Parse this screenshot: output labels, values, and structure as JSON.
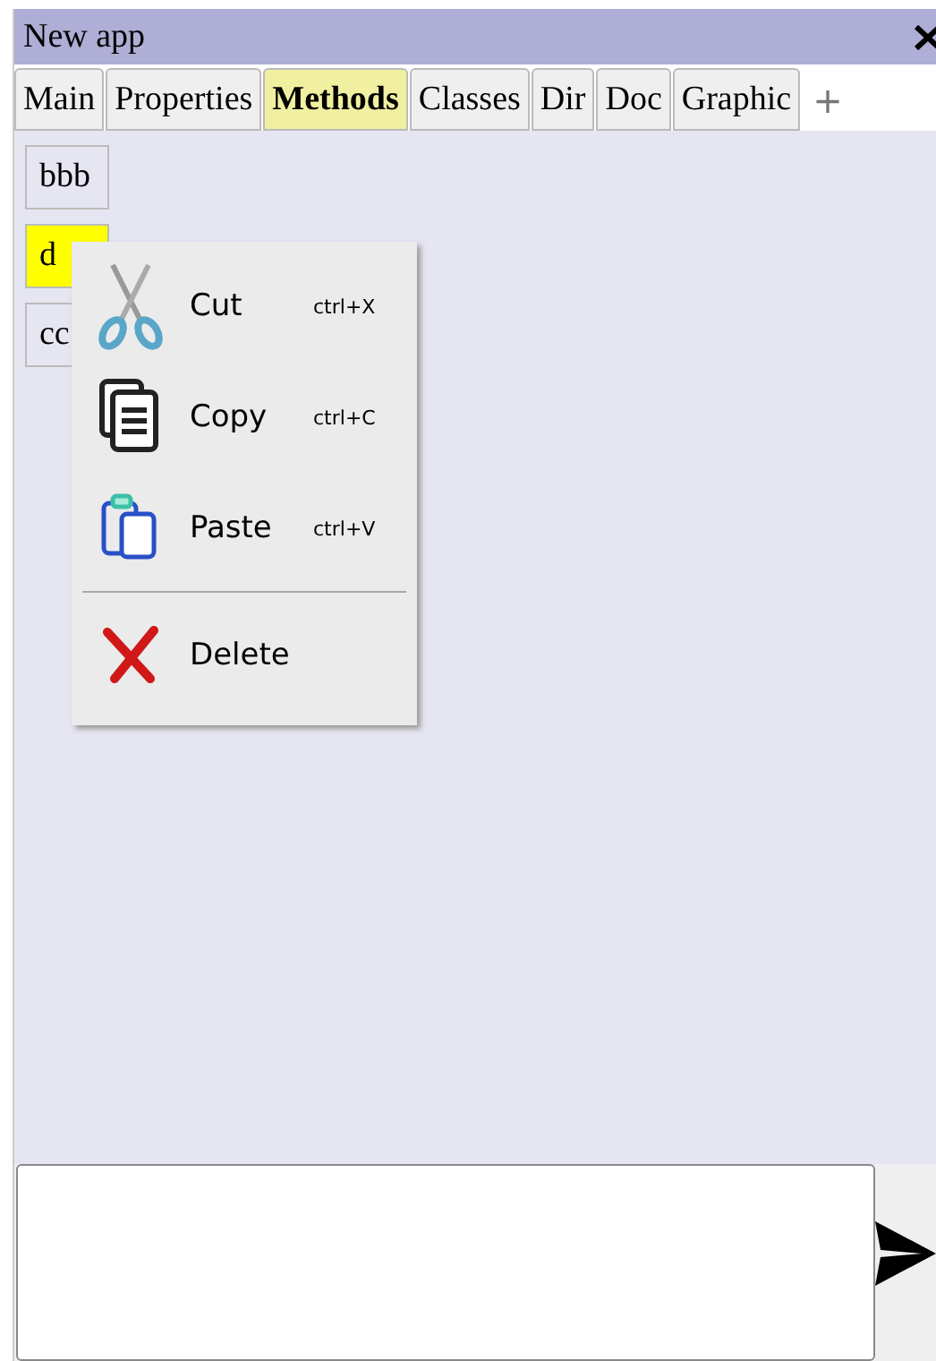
{
  "window": {
    "title": "New app"
  },
  "tabs": [
    {
      "label": "Main",
      "selected": false
    },
    {
      "label": "Properties",
      "selected": false
    },
    {
      "label": "Methods",
      "selected": true
    },
    {
      "label": "Classes",
      "selected": false
    },
    {
      "label": "Dir",
      "selected": false
    },
    {
      "label": "Doc",
      "selected": false
    },
    {
      "label": "Graphic",
      "selected": false
    }
  ],
  "add_tab": "+",
  "methods": [
    {
      "label": "bbb",
      "selected": false
    },
    {
      "label": "d",
      "selected": true
    },
    {
      "label": "cc",
      "selected": false
    }
  ],
  "context_menu": [
    {
      "kind": "cut",
      "label": "Cut",
      "shortcut": "ctrl+X"
    },
    {
      "kind": "copy",
      "label": "Copy",
      "shortcut": "ctrl+C"
    },
    {
      "kind": "paste",
      "label": "Paste",
      "shortcut": "ctrl+V"
    },
    {
      "kind": "separator"
    },
    {
      "kind": "delete",
      "label": "Delete"
    }
  ]
}
